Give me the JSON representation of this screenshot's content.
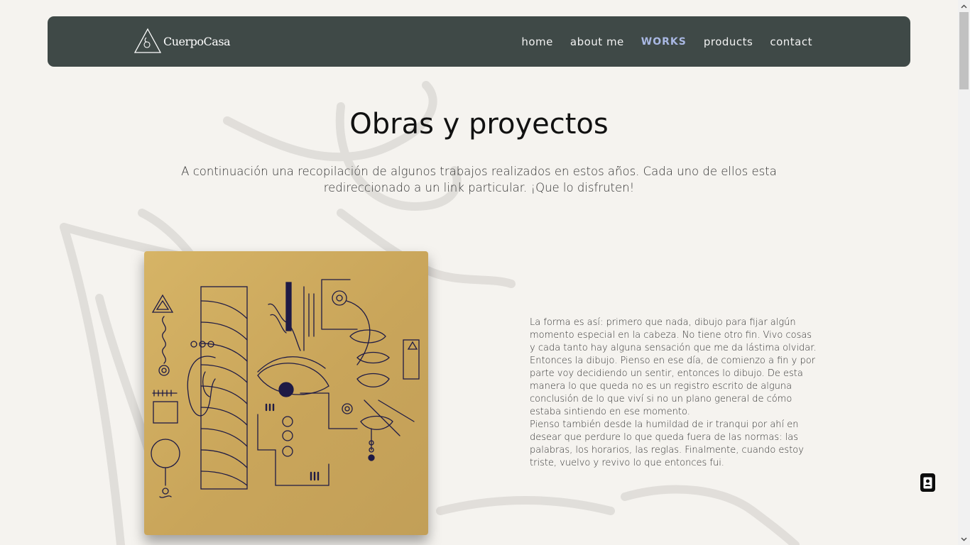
{
  "nav": {
    "logo_text": "CuerpoCasa",
    "links": [
      {
        "label": "home",
        "active": false
      },
      {
        "label": "about me",
        "active": false
      },
      {
        "label": "WORKS",
        "active": true
      },
      {
        "label": "products",
        "active": false
      },
      {
        "label": "contact",
        "active": false
      }
    ]
  },
  "main": {
    "title": "Obras y proyectos",
    "intro": "A continuación una recopilación de algunos trabajos realizados en estos años. Cada uno de ellos esta redireccionado a un link particular. ¡Que lo disfruten!",
    "work": {
      "description_p1": "La forma es así: primero que nada, dibujo para fijar algún momento especial en la cabeza. No tiene otro fin. Vivo cosas y cada tanto hay alguna sensación que me da lástima olvidar. Entonces la dibujo. Pienso en ese día, de comienzo a fin y por parte voy decidiendo un sentir, entonces lo dibujo. De esta manera lo que queda no es un registro escrito de alguna conclusión de lo que viví si no un plano general de cómo estaba sintiendo en ese momento.",
      "description_p2": "Pienso también desde la humildad de ir tranqui por ahí en desear que perdure lo que queda fuera de las normas: las palabras, los horarios, las reglas. Finalmente, cuando estoy triste, vuelvo y revivo lo que entonces fui."
    }
  },
  "colors": {
    "navbar_bg": "#3f4947",
    "nav_active": "#a9b8e3",
    "page_bg": "#f5f3ef",
    "artwork_bg": "#cfad60",
    "ink": "#1e1a45"
  },
  "icons": {
    "logo": "triangle-logo-icon",
    "fab": "contact-card-icon",
    "scroll_up": "chevron-up-icon",
    "scroll_down": "chevron-down-icon"
  }
}
